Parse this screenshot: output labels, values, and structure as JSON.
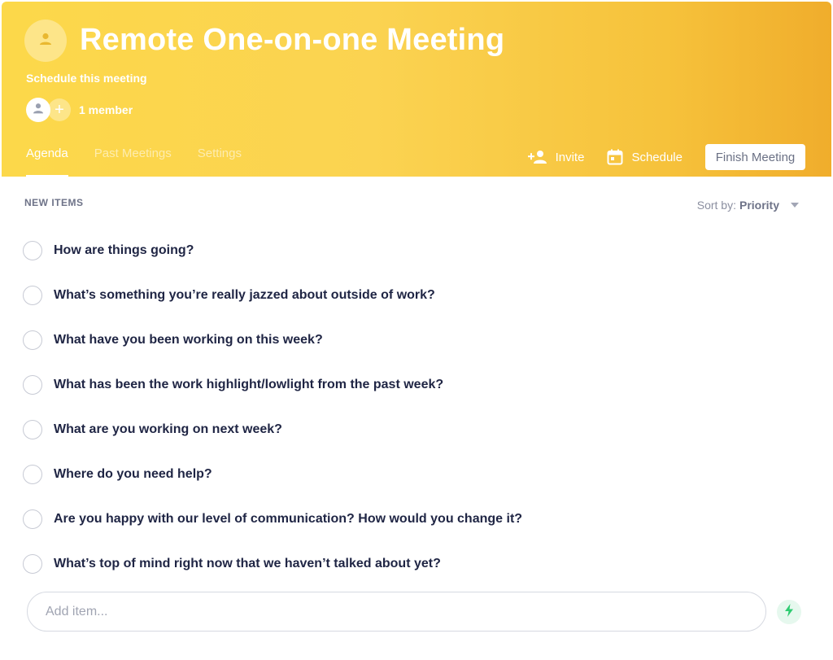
{
  "header": {
    "title": "Remote One-on-one Meeting",
    "schedule_link": "Schedule this meeting",
    "member_count": "1 member",
    "tabs": [
      {
        "label": "Agenda",
        "active": true
      },
      {
        "label": "Past Meetings",
        "active": false
      },
      {
        "label": "Settings",
        "active": false
      }
    ],
    "actions": {
      "invite_label": "Invite",
      "schedule_label": "Schedule",
      "finish_label": "Finish Meeting"
    }
  },
  "agenda": {
    "section_label": "NEW ITEMS",
    "sort_prefix": "Sort by:",
    "sort_value": "Priority",
    "items": [
      {
        "text": "How are things going?"
      },
      {
        "text": "What’s something you’re really jazzed about outside of work?"
      },
      {
        "text": "What have you been working on this week?"
      },
      {
        "text": "What has been the work highlight/lowlight from the past week?"
      },
      {
        "text": "What are you working on next week?"
      },
      {
        "text": "Where do you need help?"
      },
      {
        "text": "Are you happy with our level of communication? How would you change it?"
      },
      {
        "text": "What’s top of mind right now that we haven’t talked about yet?"
      }
    ],
    "add_item_placeholder": "Add item..."
  },
  "icons": {
    "meeting_avatar": "user-icon",
    "member_avatar": "user-icon",
    "add_member": "plus-icon",
    "invite": "add-person-icon",
    "schedule": "calendar-icon",
    "quick_add": "lightning-bolt-icon"
  },
  "colors": {
    "header_gradient_start": "#fcd84a",
    "header_gradient_end": "#f0ad2c",
    "text_primary": "#1f2544",
    "bolt_green": "#2ecc71"
  }
}
